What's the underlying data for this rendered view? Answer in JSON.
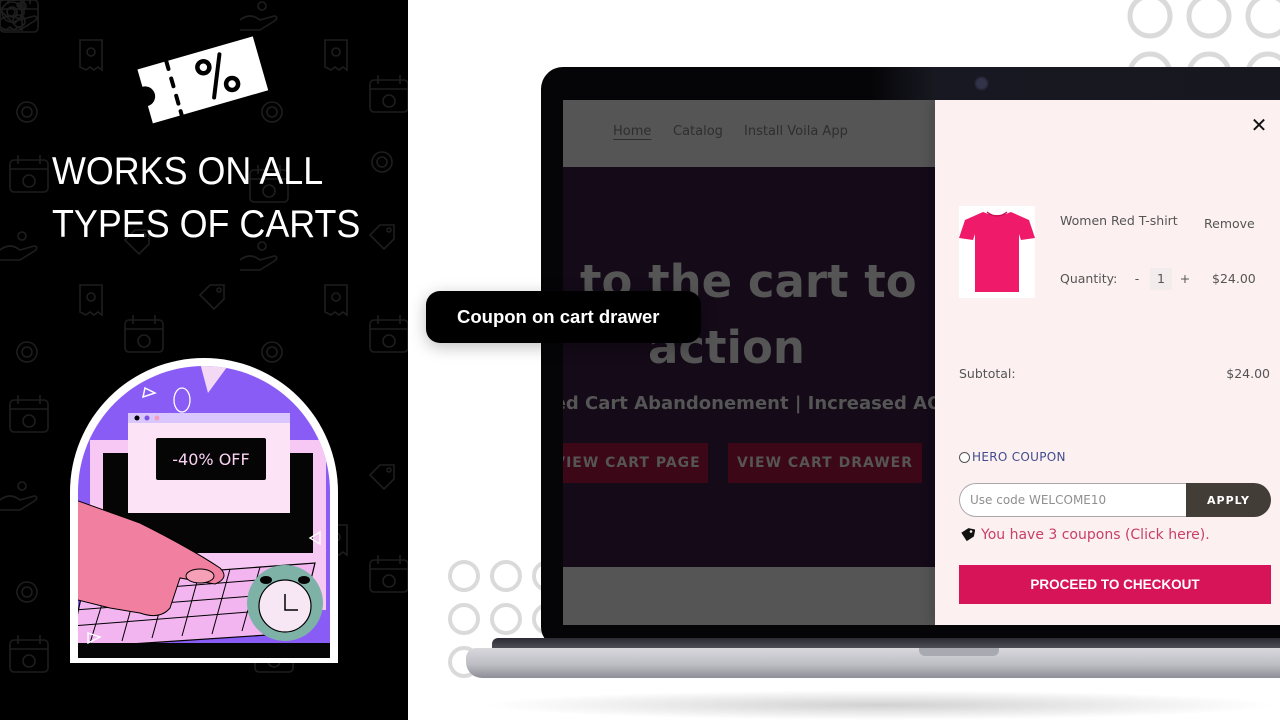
{
  "promo": {
    "headline_line1": "WORKS ON ALL",
    "headline_line2": "TYPES OF CARTS",
    "ticket_icon": "discount-ticket-icon",
    "illustration": {
      "discount_label": "-40% OFF",
      "description": "hand pressing laptop keyboard with discount popup and alarm clock"
    }
  },
  "callout": {
    "label": "Coupon on cart drawer"
  },
  "storefront": {
    "nav": [
      {
        "label": "Home",
        "active": true
      },
      {
        "label": "Catalog",
        "active": false
      },
      {
        "label": "Install Voila App",
        "active": false
      }
    ],
    "hero_title_line1": "to the cart to",
    "hero_title_line2": "action",
    "hero_subtitle": "ced Cart Abandonement | Increased AO",
    "buttons": [
      {
        "label": "VIEW CART PAGE"
      },
      {
        "label": "VIEW CART DRAWER"
      }
    ]
  },
  "cart_drawer": {
    "close_icon": "close-icon",
    "item": {
      "name": "Women Red T-shirt",
      "remove_label": "Remove",
      "quantity_label": "Quantity:",
      "decrement": "-",
      "quantity": "1",
      "increment": "+",
      "price": "$24.00"
    },
    "subtotal_label": "Subtotal:",
    "subtotal_value": "$24.00",
    "hero_coupon_label": "HERO COUPON",
    "coupon_input": {
      "value": "",
      "placeholder": "Use code WELCOME10"
    },
    "apply_label": "APPLY",
    "coupons_note": "You have 3 coupons (Click here).",
    "checkout_label": "PROCEED TO CHECKOUT"
  },
  "colors": {
    "checkout": "#d81458",
    "apply": "#433d37",
    "coupon_link": "#c83e6a",
    "hero_coupon": "#3f4d8e",
    "drawer_bg": "#fcf0f1",
    "left_panel": "#000000"
  }
}
